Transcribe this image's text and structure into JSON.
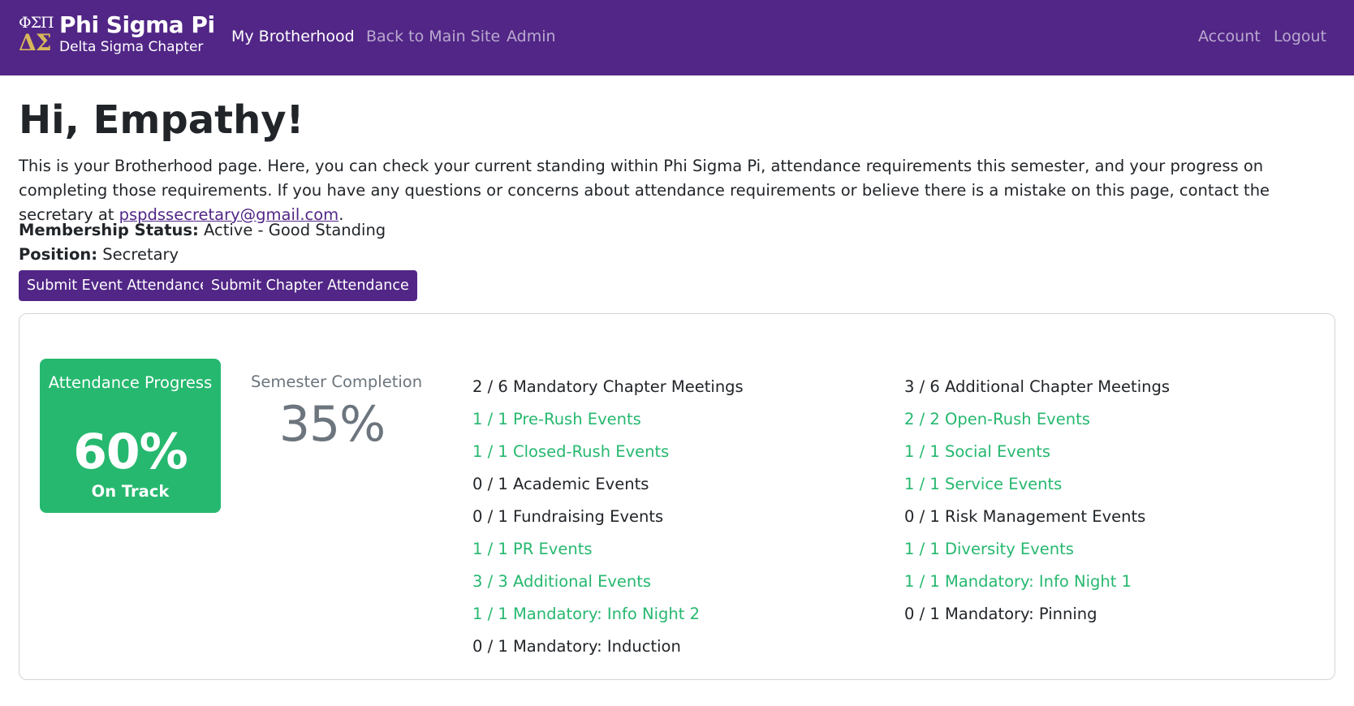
{
  "brand": {
    "greek_top": "ΦΣΠ",
    "greek_bottom": "ΔΣ",
    "name": "Phi Sigma Pi",
    "chapter": "Delta Sigma Chapter"
  },
  "nav": {
    "my_brotherhood": "My Brotherhood",
    "main_site": "Back to Main Site",
    "admin": "Admin",
    "account": "Account",
    "logout": "Logout"
  },
  "page": {
    "greeting": "Hi, Empathy!",
    "intro": "This is your Brotherhood page. Here, you can check your current standing within Phi Sigma Pi, attendance requirements this semester, and your progress on completing those requirements. If you have any questions or concerns about attendance requirements or believe there is a mistake on this page, contact the secretary at ",
    "email": "pspdssecretary@gmail.com",
    "intro_end": "."
  },
  "member": {
    "status_label": "Membership Status:",
    "status_value": "Active - Good Standing",
    "position_label": "Position:",
    "position_value": "Secretary"
  },
  "buttons": {
    "event_attendance": "Submit Event Attendance",
    "chapter_attendance": "Submit Chapter Attendance"
  },
  "progress": {
    "label": "Attendance Progress",
    "value": "60%",
    "status": "On Track",
    "color": "#26b86f"
  },
  "completion": {
    "label": "Semester Completion",
    "value": "35%"
  },
  "requirements_left": [
    {
      "text": "2 / 6 Mandatory Chapter Meetings",
      "met": false
    },
    {
      "text": "1 / 1 Pre-Rush Events",
      "met": true
    },
    {
      "text": "1 / 1 Closed-Rush Events",
      "met": true
    },
    {
      "text": "0 / 1 Academic Events",
      "met": false
    },
    {
      "text": "0 / 1 Fundraising Events",
      "met": false
    },
    {
      "text": "1 / 1 PR Events",
      "met": true
    },
    {
      "text": "3 / 3 Additional Events",
      "met": true
    },
    {
      "text": "1 / 1 Mandatory: Info Night 2",
      "met": true
    },
    {
      "text": "0 / 1 Mandatory: Induction",
      "met": false
    }
  ],
  "requirements_right": [
    {
      "text": "3 / 6 Additional Chapter Meetings",
      "met": false
    },
    {
      "text": "2 / 2 Open-Rush Events",
      "met": true
    },
    {
      "text": "1 / 1 Social Events",
      "met": true
    },
    {
      "text": "1 / 1 Service Events",
      "met": true
    },
    {
      "text": "0 / 1 Risk Management Events",
      "met": false
    },
    {
      "text": "1 / 1 Diversity Events",
      "met": true
    },
    {
      "text": "1 / 1 Mandatory: Info Night 1",
      "met": true
    },
    {
      "text": "0 / 1 Mandatory: Pinning",
      "met": false
    }
  ],
  "colors": {
    "brand_purple": "#512686",
    "met_green": "#26b86f",
    "greek_gold": "#d8b75a"
  }
}
